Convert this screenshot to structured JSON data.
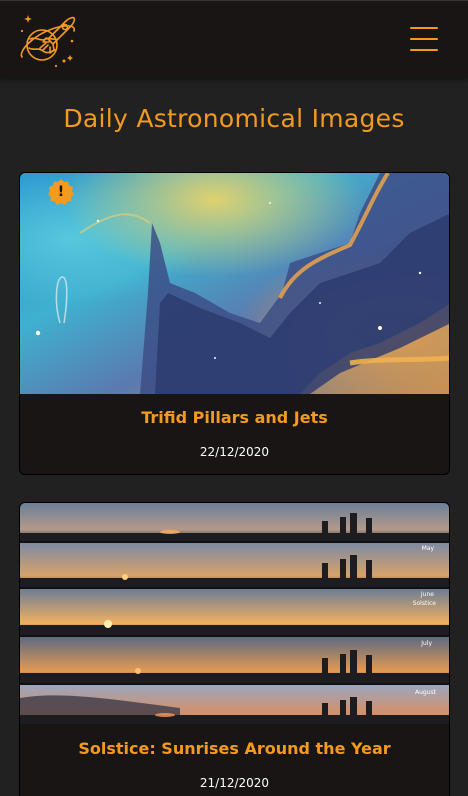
{
  "navbar": {
    "logo_icon": "rocket-planet-logo-icon",
    "menu_icon": "hamburger-menu-icon",
    "accent_color": "#f39a1f"
  },
  "page": {
    "title": "Daily Astronomical Images"
  },
  "cards": [
    {
      "title": "Trifid Pillars and Jets",
      "date": "22/12/2020",
      "badge_text": "!",
      "image": "nebula-image"
    },
    {
      "title": "Solstice: Sunrises Around the Year",
      "date": "21/12/2020",
      "image": "sunrise-panorama-image",
      "strip_labels": [
        "May",
        "June",
        "Solstice",
        "July",
        "August"
      ]
    }
  ]
}
